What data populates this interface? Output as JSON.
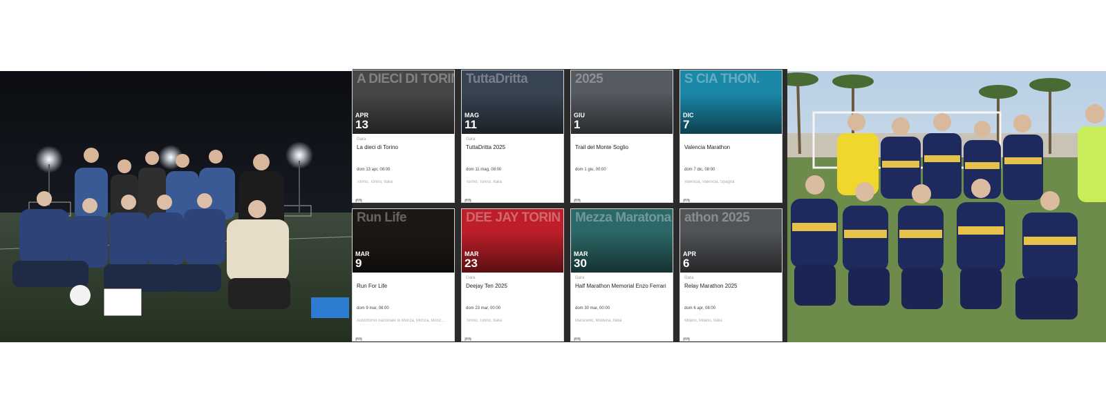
{
  "events": [
    {
      "month": "APR",
      "day": "13",
      "kind": "Gara",
      "name": "La dieci di Torino",
      "when": "dom 13 apr, 08:00",
      "where": "Torino, Torino, Italia",
      "cover_text": "A DIECI DI TORINO",
      "cover_color": "#4b4b4b"
    },
    {
      "month": "MAG",
      "day": "11",
      "kind": "Gara",
      "name": "TuttaDritta 2025",
      "when": "dom 11 mag, 08:00",
      "where": "Torino, Torino, Italia",
      "cover_text": "TuttaDritta",
      "cover_color": "#3a4756"
    },
    {
      "month": "GIU",
      "day": "1",
      "kind": "",
      "name": "Trail del Monte Soglio",
      "when": "dom 1 giu, 00:00",
      "where": "",
      "cover_text": "2025",
      "cover_color": "#5a5f66"
    },
    {
      "month": "DIC",
      "day": "7",
      "kind": "",
      "name": "Valencia Marathon",
      "when": "dom 7 dic, 08:00",
      "where": "Valencia, Valencia, Spagna",
      "cover_text": "S CIA THON.",
      "cover_color": "#1c8fb0"
    },
    {
      "month": "MAR",
      "day": "9",
      "kind": "",
      "name": "Run For Life",
      "when": "dom 9 mar, 08:00",
      "where": "Autodromo nazionale di Monza, Monza, Monz...",
      "cover_text": "Run Life",
      "cover_color": "#1e1a16"
    },
    {
      "month": "MAR",
      "day": "23",
      "kind": "Gara",
      "name": "Deejay Ten 2025",
      "when": "dom 23 mar, 00:00",
      "where": "Torino, Torino, Italia",
      "cover_text": "DEE JAY TORIN",
      "cover_color": "#c8202b"
    },
    {
      "month": "MAR",
      "day": "30",
      "kind": "Gara",
      "name": "Half Marathon Memorial Enzo Ferrari",
      "when": "dom 30 mar, 00:00",
      "where": "Maranello, Modena, Italia",
      "cover_text": "Mezza Maratona",
      "cover_color": "#2f6e6d"
    },
    {
      "month": "APR",
      "day": "6",
      "kind": "Gara",
      "name": "Relay Marathon 2025",
      "when": "dom 6 apr, 08:00",
      "where": "Milano, Milano, Italia",
      "cover_text": "athon 2025",
      "cover_color": "#55585c"
    }
  ],
  "icons": {
    "calendar": "calendar-icon"
  },
  "colors": {
    "card_bg": "#ffffff",
    "muted_text": "#9a9a9a",
    "grid_bg": "#2b2b2b"
  }
}
